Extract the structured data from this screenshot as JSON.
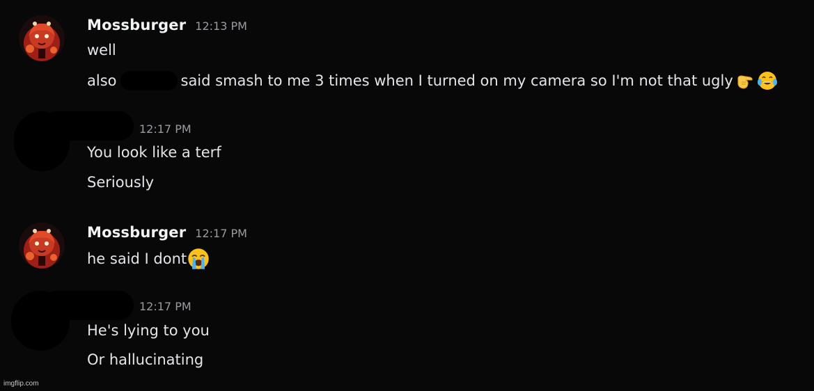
{
  "messages": {
    "group1": {
      "username": "Mossburger",
      "timestamp": "12:13 PM",
      "line1": "well",
      "line2_prefix": "also",
      "line2_suffix": "said smash to me 3 times when I turned on my camera so I'm not that ugly"
    },
    "group2": {
      "timestamp": "12:17 PM",
      "line1": "You look like a terf",
      "line2": "Seriously"
    },
    "group3": {
      "username": "Mossburger",
      "timestamp": "12:17 PM",
      "line1": "he said I dont"
    },
    "group4": {
      "timestamp": "12:17 PM",
      "line1": "He's lying to you",
      "line2": "Or hallucinating"
    }
  },
  "watermark": "imgflip.com",
  "icons": {
    "avatar": "cookie-avatar-icon",
    "pointing": "pointing-hand-emoji-icon",
    "laughing": "tears-of-joy-emoji-icon",
    "crying": "loudly-crying-emoji-icon"
  },
  "colors": {
    "background": "#080808",
    "username": "#f2f3f5",
    "timestamp": "#9a9ca2",
    "message": "#e4e5e8"
  }
}
